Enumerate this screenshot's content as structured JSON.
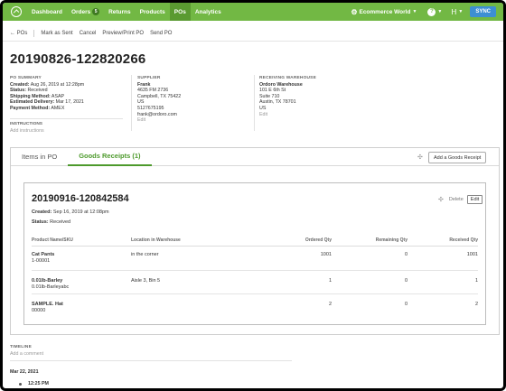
{
  "nav": {
    "items": [
      {
        "label": "Dashboard"
      },
      {
        "label": "Orders",
        "badge": "5"
      },
      {
        "label": "Returns"
      },
      {
        "label": "Products"
      },
      {
        "label": "POs",
        "active": true
      },
      {
        "label": "Analytics"
      }
    ],
    "account": "Ecommerce World",
    "help": "?",
    "sync": "SYNC",
    "brand_color": "#72b844",
    "sync_color": "#3d8fd3"
  },
  "actions": {
    "back": "← POs",
    "mark_sent": "Mark as Sent",
    "cancel": "Cancel",
    "preview": "Preview/Print PO",
    "send": "Send PO"
  },
  "po": {
    "number": "20190826-122820266",
    "summary": {
      "heading": "PO SUMMARY",
      "created_label": "Created:",
      "created": "Aug 26, 2019 at 12:28pm",
      "status_label": "Status:",
      "status": "Received",
      "shipping_label": "Shipping Method:",
      "shipping": "ASAP",
      "delivery_label": "Estimated Delivery:",
      "delivery": "Mar 17, 2021",
      "payment_label": "Payment Method:",
      "payment": "AMEX"
    },
    "instructions": {
      "heading": "INSTRUCTIONS",
      "add": "Add instructions"
    },
    "supplier": {
      "heading": "SUPPLIER",
      "name": "Frank",
      "addr1": "4635 FM 2736",
      "addr2": "Campbell, TX 75422",
      "country": "US",
      "phone": "5127675195",
      "email": "frank@ordoro.com",
      "edit": "Edit"
    },
    "warehouse": {
      "heading": "RECEIVING WAREHOUSE",
      "name": "Ordoro Warehouse",
      "addr1": "101 E 6th St",
      "addr2": "Suite 710",
      "addr3": "Austin, TX 78701",
      "country": "US",
      "edit": "Edit"
    }
  },
  "tabs": {
    "items_in_po": "Items in PO",
    "goods_receipts": "Goods Receipts (1)",
    "add_button": "Add a Goods Receipt"
  },
  "receipt": {
    "number": "20190916-120842584",
    "created_label": "Created:",
    "created": "Sep 16, 2019 at 12:08pm",
    "status_label": "Status:",
    "status": "Received",
    "delete": "Delete",
    "edit": "Edit",
    "columns": [
      "Product Name/SKU",
      "Location in Warehouse",
      "Ordered Qty",
      "Remaining Qty",
      "Received Qty"
    ],
    "rows": [
      {
        "name": "Cat Pants",
        "sku": "1-00001",
        "location": "in the corner",
        "ordered": "1001",
        "remaining": "0",
        "received": "1001"
      },
      {
        "name": "0.01lb-Barley",
        "sku": "0.01lb-Barleyabc",
        "location": "Aisle 3, Bin 5",
        "ordered": "1",
        "remaining": "0",
        "received": "1"
      },
      {
        "name": "SAMPLE. Hat",
        "sku": "00000",
        "location": "",
        "ordered": "2",
        "remaining": "0",
        "received": "2"
      }
    ]
  },
  "timeline": {
    "heading": "TIMELINE",
    "add": "Add a comment",
    "date": "Mar 22, 2021",
    "time": "12:25 PM"
  }
}
